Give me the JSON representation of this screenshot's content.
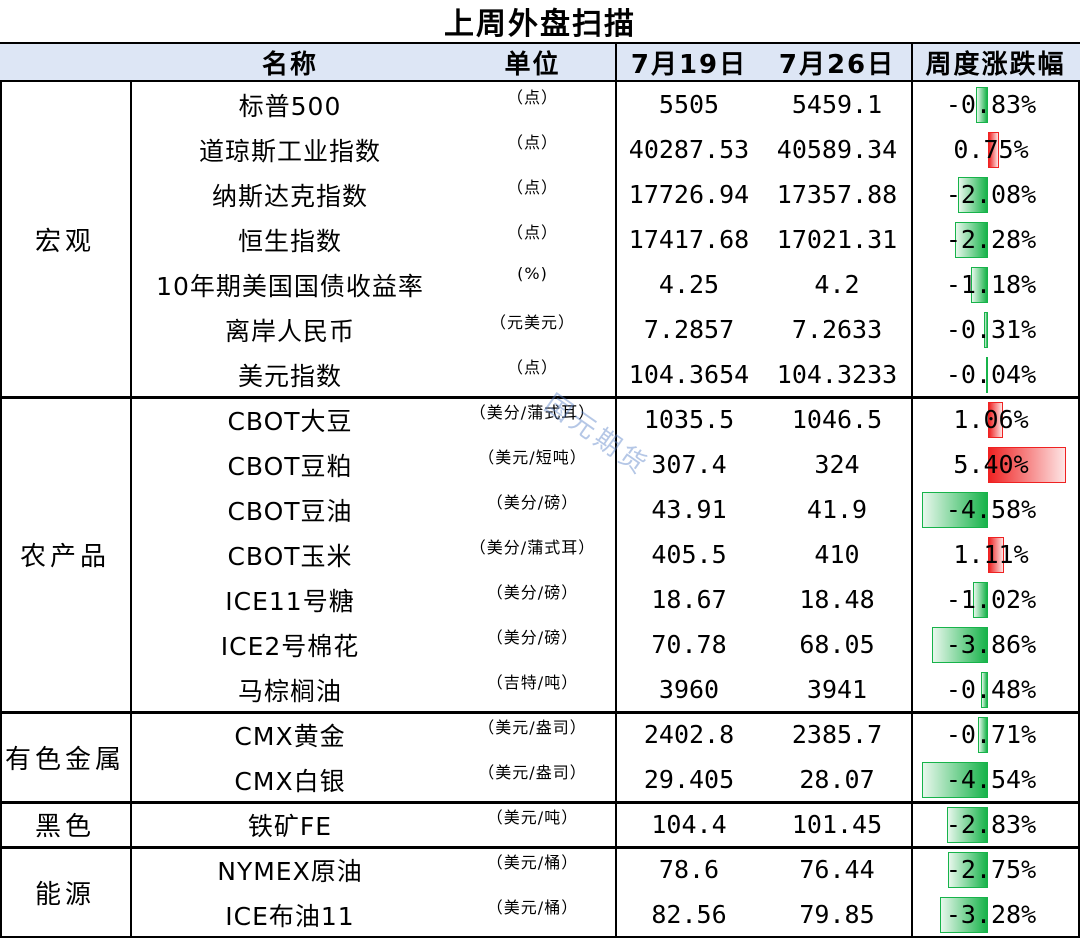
{
  "title": "上周外盘扫描",
  "header": {
    "name": "名称",
    "unit": "单位",
    "date1": "7月19日",
    "date2": "7月26日",
    "change": "周度涨跌幅"
  },
  "watermark": "国元期货",
  "colors": {
    "header_bg": "#dde6f5",
    "negative_bar": "#17b34a",
    "positive_bar": "#ef2222"
  },
  "categories": [
    {
      "label": "宏观",
      "rows": [
        {
          "name": "标普500",
          "unit": "（点）",
          "v1": "5505",
          "v2": "5459.1",
          "change_text": "-0.83%",
          "change_pct": -0.83
        },
        {
          "name": "道琼斯工业指数",
          "unit": "（点）",
          "v1": "40287.53",
          "v2": "40589.34",
          "change_text": "0.75%",
          "change_pct": 0.75
        },
        {
          "name": "纳斯达克指数",
          "unit": "（点）",
          "v1": "17726.94",
          "v2": "17357.88",
          "change_text": "-2.08%",
          "change_pct": -2.08
        },
        {
          "name": "恒生指数",
          "unit": "（点）",
          "v1": "17417.68",
          "v2": "17021.31",
          "change_text": "-2.28%",
          "change_pct": -2.28
        },
        {
          "name": "10年期美国国债收益率",
          "unit": "(%)",
          "v1": "4.25",
          "v2": "4.2",
          "change_text": "-1.18%",
          "change_pct": -1.18
        },
        {
          "name": "离岸人民币",
          "unit": "（元美元）",
          "v1": "7.2857",
          "v2": "7.2633",
          "change_text": "-0.31%",
          "change_pct": -0.31
        },
        {
          "name": "美元指数",
          "unit": "（点）",
          "v1": "104.3654",
          "v2": "104.3233",
          "change_text": "-0.04%",
          "change_pct": -0.04
        }
      ]
    },
    {
      "label": "农产品",
      "rows": [
        {
          "name": "CBOT大豆",
          "unit": "（美分/蒲式耳）",
          "v1": "1035.5",
          "v2": "1046.5",
          "change_text": "1.06%",
          "change_pct": 1.06
        },
        {
          "name": "CBOT豆粕",
          "unit": "（美元/短吨）",
          "v1": "307.4",
          "v2": "324",
          "change_text": "5.40%",
          "change_pct": 5.4
        },
        {
          "name": "CBOT豆油",
          "unit": "（美分/磅）",
          "v1": "43.91",
          "v2": "41.9",
          "change_text": "-4.58%",
          "change_pct": -4.58
        },
        {
          "name": "CBOT玉米",
          "unit": "（美分/蒲式耳）",
          "v1": "405.5",
          "v2": "410",
          "change_text": "1.11%",
          "change_pct": 1.11
        },
        {
          "name": "ICE11号糖",
          "unit": "（美分/磅）",
          "v1": "18.67",
          "v2": "18.48",
          "change_text": "-1.02%",
          "change_pct": -1.02
        },
        {
          "name": "ICE2号棉花",
          "unit": "（美分/磅）",
          "v1": "70.78",
          "v2": "68.05",
          "change_text": "-3.86%",
          "change_pct": -3.86
        },
        {
          "name": "马棕榈油",
          "unit": "（吉特/吨）",
          "v1": "3960",
          "v2": "3941",
          "change_text": "-0.48%",
          "change_pct": -0.48
        }
      ]
    },
    {
      "label": "有色金属",
      "rows": [
        {
          "name": "CMX黄金",
          "unit": "（美元/盎司）",
          "v1": "2402.8",
          "v2": "2385.7",
          "change_text": "-0.71%",
          "change_pct": -0.71
        },
        {
          "name": "CMX白银",
          "unit": "（美元/盎司）",
          "v1": "29.405",
          "v2": "28.07",
          "change_text": "-4.54%",
          "change_pct": -4.54
        }
      ]
    },
    {
      "label": "黑色",
      "rows": [
        {
          "name": "铁矿FE",
          "unit": "（美元/吨）",
          "v1": "104.4",
          "v2": "101.45",
          "change_text": "-2.83%",
          "change_pct": -2.83
        }
      ]
    },
    {
      "label": "能源",
      "rows": [
        {
          "name": "NYMEX原油",
          "unit": "（美元/桶）",
          "v1": "78.6",
          "v2": "76.44",
          "change_text": "-2.75%",
          "change_pct": -2.75
        },
        {
          "name": "ICE布油11",
          "unit": "（美元/桶）",
          "v1": "82.56",
          "v2": "79.85",
          "change_text": "-3.28%",
          "change_pct": -3.28
        }
      ]
    }
  ]
}
